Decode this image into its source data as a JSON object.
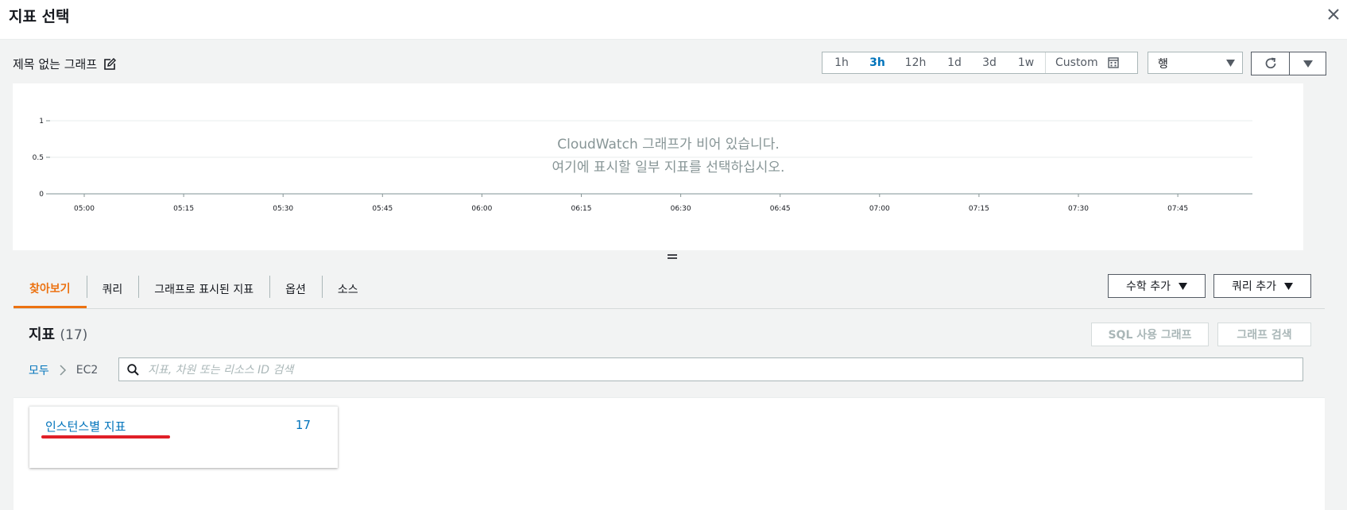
{
  "modal": {
    "title": "지표 선택"
  },
  "graph": {
    "title": "제목 없는 그래프",
    "time_ranges": [
      "1h",
      "3h",
      "12h",
      "1d",
      "3d",
      "1w"
    ],
    "active_range": "3h",
    "custom_label": "Custom",
    "view_type": "행",
    "empty_message_line1": "CloudWatch 그래프가 비어 있습니다.",
    "empty_message_line2": "여기에 표시할 일부 지표를 선택하십시오."
  },
  "chart_data": {
    "type": "line",
    "x_ticks": [
      "05:00",
      "05:15",
      "05:30",
      "05:45",
      "06:00",
      "06:15",
      "06:30",
      "06:45",
      "07:00",
      "07:15",
      "07:30",
      "07:45"
    ],
    "y_ticks": [
      "1",
      "0.5",
      "0"
    ],
    "ylim": [
      0,
      1
    ],
    "series": [],
    "grid": true
  },
  "tabs": [
    {
      "label": "찾아보기",
      "active": true
    },
    {
      "label": "쿼리",
      "active": false
    },
    {
      "label": "그래프로 표시된 지표",
      "active": false
    },
    {
      "label": "옵션",
      "active": false
    },
    {
      "label": "소스",
      "active": false
    }
  ],
  "actions": {
    "add_math": "수학 추가",
    "add_query": "쿼리 추가"
  },
  "metrics": {
    "title": "지표",
    "count": "(17)",
    "sql_graph": "SQL 사용 그래프",
    "graph_search": "그래프 검색",
    "breadcrumb_all": "모두",
    "breadcrumb_current": "EC2",
    "search_placeholder": "지표, 차원 또는 리소스 ID 검색",
    "card_label": "인스턴스별 지표",
    "card_count": "17"
  },
  "colors": {
    "accent": "#ec7211",
    "link": "#0073bb",
    "annotation": "#e01f27"
  },
  "icons": [
    "close-icon",
    "edit-icon",
    "calendar-icon",
    "caret-down-icon",
    "refresh-icon",
    "search-icon",
    "chevron-right-icon",
    "drag-handle-icon"
  ]
}
